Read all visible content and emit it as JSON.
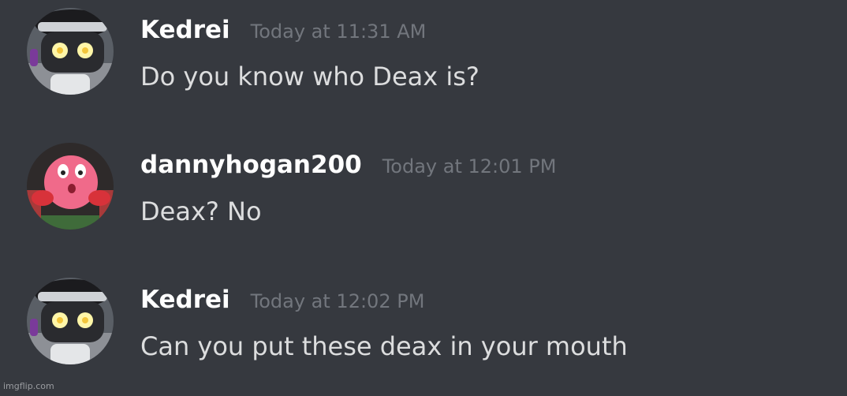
{
  "channel": {
    "background": "#36393f",
    "messages": [
      {
        "author": "Kedrei",
        "timestamp": "Today at 11:31 AM",
        "content": "Do you know who Deax is?",
        "avatar_icon": "robot-avatar-icon"
      },
      {
        "author": "dannyhogan200",
        "timestamp": "Today at 12:01 PM",
        "content": "Deax? No",
        "avatar_icon": "kirby-avatar-icon"
      },
      {
        "author": "Kedrei",
        "timestamp": "Today at 12:02 PM",
        "content": "Can you put these deax in your mouth",
        "avatar_icon": "robot-avatar-icon"
      }
    ]
  },
  "colors": {
    "username": "#ffffff",
    "timestamp": "#72767d",
    "message_text": "#dcddde"
  },
  "watermark": "imgflip.com"
}
